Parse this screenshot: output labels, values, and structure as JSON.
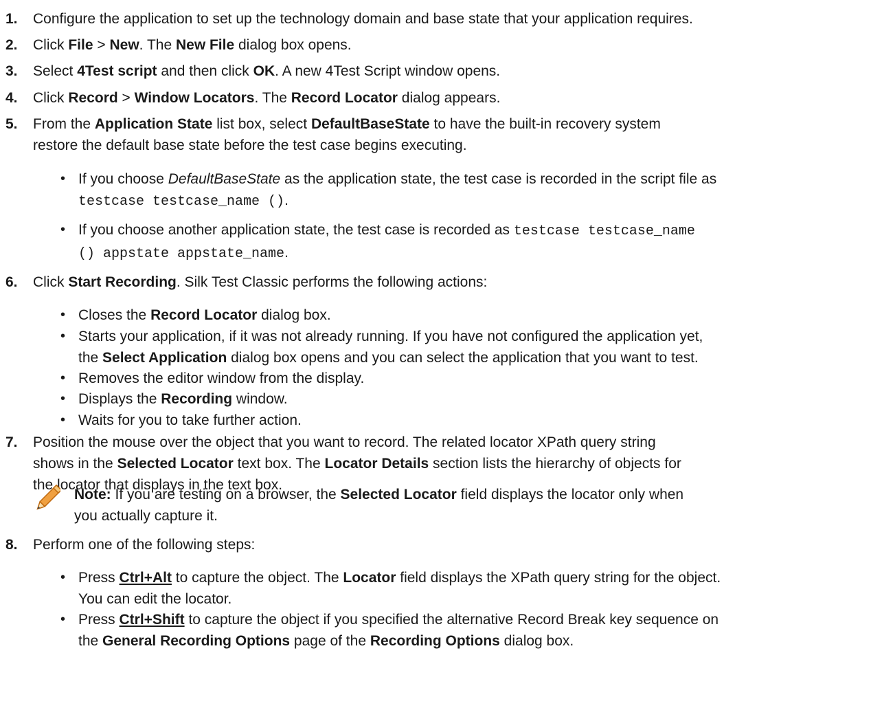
{
  "steps": [
    {
      "num": "1.",
      "segments": [
        {
          "t": "Configure the application to set up the technology domain and base state that your application requires."
        }
      ]
    },
    {
      "num": "2.",
      "segments": [
        {
          "t": "Click "
        },
        {
          "t": "File",
          "b": true
        },
        {
          "t": " > "
        },
        {
          "t": "New",
          "b": true
        },
        {
          "t": ". The "
        },
        {
          "t": "New File",
          "b": true
        },
        {
          "t": " dialog box opens."
        }
      ]
    },
    {
      "num": "3.",
      "segments": [
        {
          "t": "Select "
        },
        {
          "t": "4Test script",
          "b": true
        },
        {
          "t": " and then click "
        },
        {
          "t": "OK",
          "b": true
        },
        {
          "t": ". A new 4Test Script window opens."
        }
      ]
    },
    {
      "num": "4.",
      "segments": [
        {
          "t": "Click "
        },
        {
          "t": "Record",
          "b": true
        },
        {
          "t": " > "
        },
        {
          "t": "Window Locators",
          "b": true
        },
        {
          "t": ". The "
        },
        {
          "t": "Record Locator",
          "b": true
        },
        {
          "t": " dialog appears."
        }
      ]
    },
    {
      "num": "5.",
      "segments": [
        {
          "t": "From the "
        },
        {
          "t": "Application State",
          "b": true
        },
        {
          "t": " list box, select "
        },
        {
          "t": "DefaultBaseState",
          "b": true
        },
        {
          "t": " to have the built-in recovery system"
        },
        {
          "br": true
        },
        {
          "t": "restore the default base state before the test case begins executing."
        }
      ]
    },
    {
      "num": "6.",
      "segments": [
        {
          "t": "Click "
        },
        {
          "t": "Start Recording",
          "b": true
        },
        {
          "t": ". Silk Test Classic performs the following actions:"
        }
      ]
    },
    {
      "num": "7.",
      "segments": [
        {
          "t": "Position the mouse over the object that you want to record. The related locator XPath query string"
        },
        {
          "br": true
        },
        {
          "t": "shows in the "
        },
        {
          "t": "Selected Locator",
          "b": true
        },
        {
          "t": " text box. The "
        },
        {
          "t": "Locator Details",
          "b": true
        },
        {
          "t": " section lists the hierarchy of objects for"
        },
        {
          "br": true
        },
        {
          "t": "the locator that displays in the text box."
        }
      ]
    },
    {
      "num": "8.",
      "segments": [
        {
          "t": "Perform one of the following steps:"
        }
      ]
    }
  ],
  "bullets": [
    {
      "mark": "•",
      "segments": [
        {
          "t": "If you choose "
        },
        {
          "t": "DefaultBaseState",
          "i": true
        },
        {
          "t": " as the application state, the test case is recorded in the script file as"
        },
        {
          "br": true
        },
        {
          "t": "testcase testcase_name ()",
          "c": true
        },
        {
          "t": "."
        }
      ]
    },
    {
      "mark": "•",
      "segments": [
        {
          "t": "If you choose another application state, the test case is recorded as "
        },
        {
          "t": "testcase testcase_name",
          "c": true
        },
        {
          "br": true
        },
        {
          "t": "() appstate appstate_name",
          "c": true
        },
        {
          "t": "."
        }
      ]
    },
    {
      "mark": "•",
      "segments": [
        {
          "t": "Closes the "
        },
        {
          "t": "Record Locator",
          "b": true
        },
        {
          "t": " dialog box."
        }
      ]
    },
    {
      "mark": "•",
      "segments": [
        {
          "t": "Starts your application, if it was not already running. If you have not configured the application yet,"
        },
        {
          "br": true
        },
        {
          "t": "the "
        },
        {
          "t": "Select Application",
          "b": true
        },
        {
          "t": " dialog box opens and you can select the application that you want to test."
        }
      ]
    },
    {
      "mark": "•",
      "segments": [
        {
          "t": "Removes the editor window from the display."
        }
      ]
    },
    {
      "mark": "•",
      "segments": [
        {
          "t": "Displays the "
        },
        {
          "t": "Recording",
          "b": true
        },
        {
          "t": " window."
        }
      ]
    },
    {
      "mark": "•",
      "segments": [
        {
          "t": "Waits for you to take further action."
        }
      ]
    },
    {
      "mark": "•",
      "segments": [
        {
          "t": "Press "
        },
        {
          "t": "Ctrl+Alt",
          "k": true
        },
        {
          "t": " to capture the object. The "
        },
        {
          "t": "Locator",
          "b": true
        },
        {
          "t": " field displays the XPath query string for the object."
        },
        {
          "br": true
        },
        {
          "t": "You can edit the locator."
        }
      ]
    },
    {
      "mark": "•",
      "segments": [
        {
          "t": "Press "
        },
        {
          "t": "Ctrl+Shift",
          "k": true
        },
        {
          "t": " to capture the object if you specified the alternative Record Break key sequence on"
        },
        {
          "br": true
        },
        {
          "t": "the "
        },
        {
          "t": "General Recording Options",
          "b": true
        },
        {
          "t": " page of the "
        },
        {
          "t": "Recording Options",
          "b": true
        },
        {
          "t": " dialog box."
        }
      ]
    }
  ],
  "note": {
    "icon": "pencil-icon",
    "segments": [
      {
        "t": "Note:",
        "b": true
      },
      {
        "t": " If you are testing on a browser, the "
      },
      {
        "t": "Selected Locator",
        "b": true
      },
      {
        "t": " field displays the locator only when"
      },
      {
        "br": true
      },
      {
        "t": "you actually capture it."
      }
    ]
  }
}
